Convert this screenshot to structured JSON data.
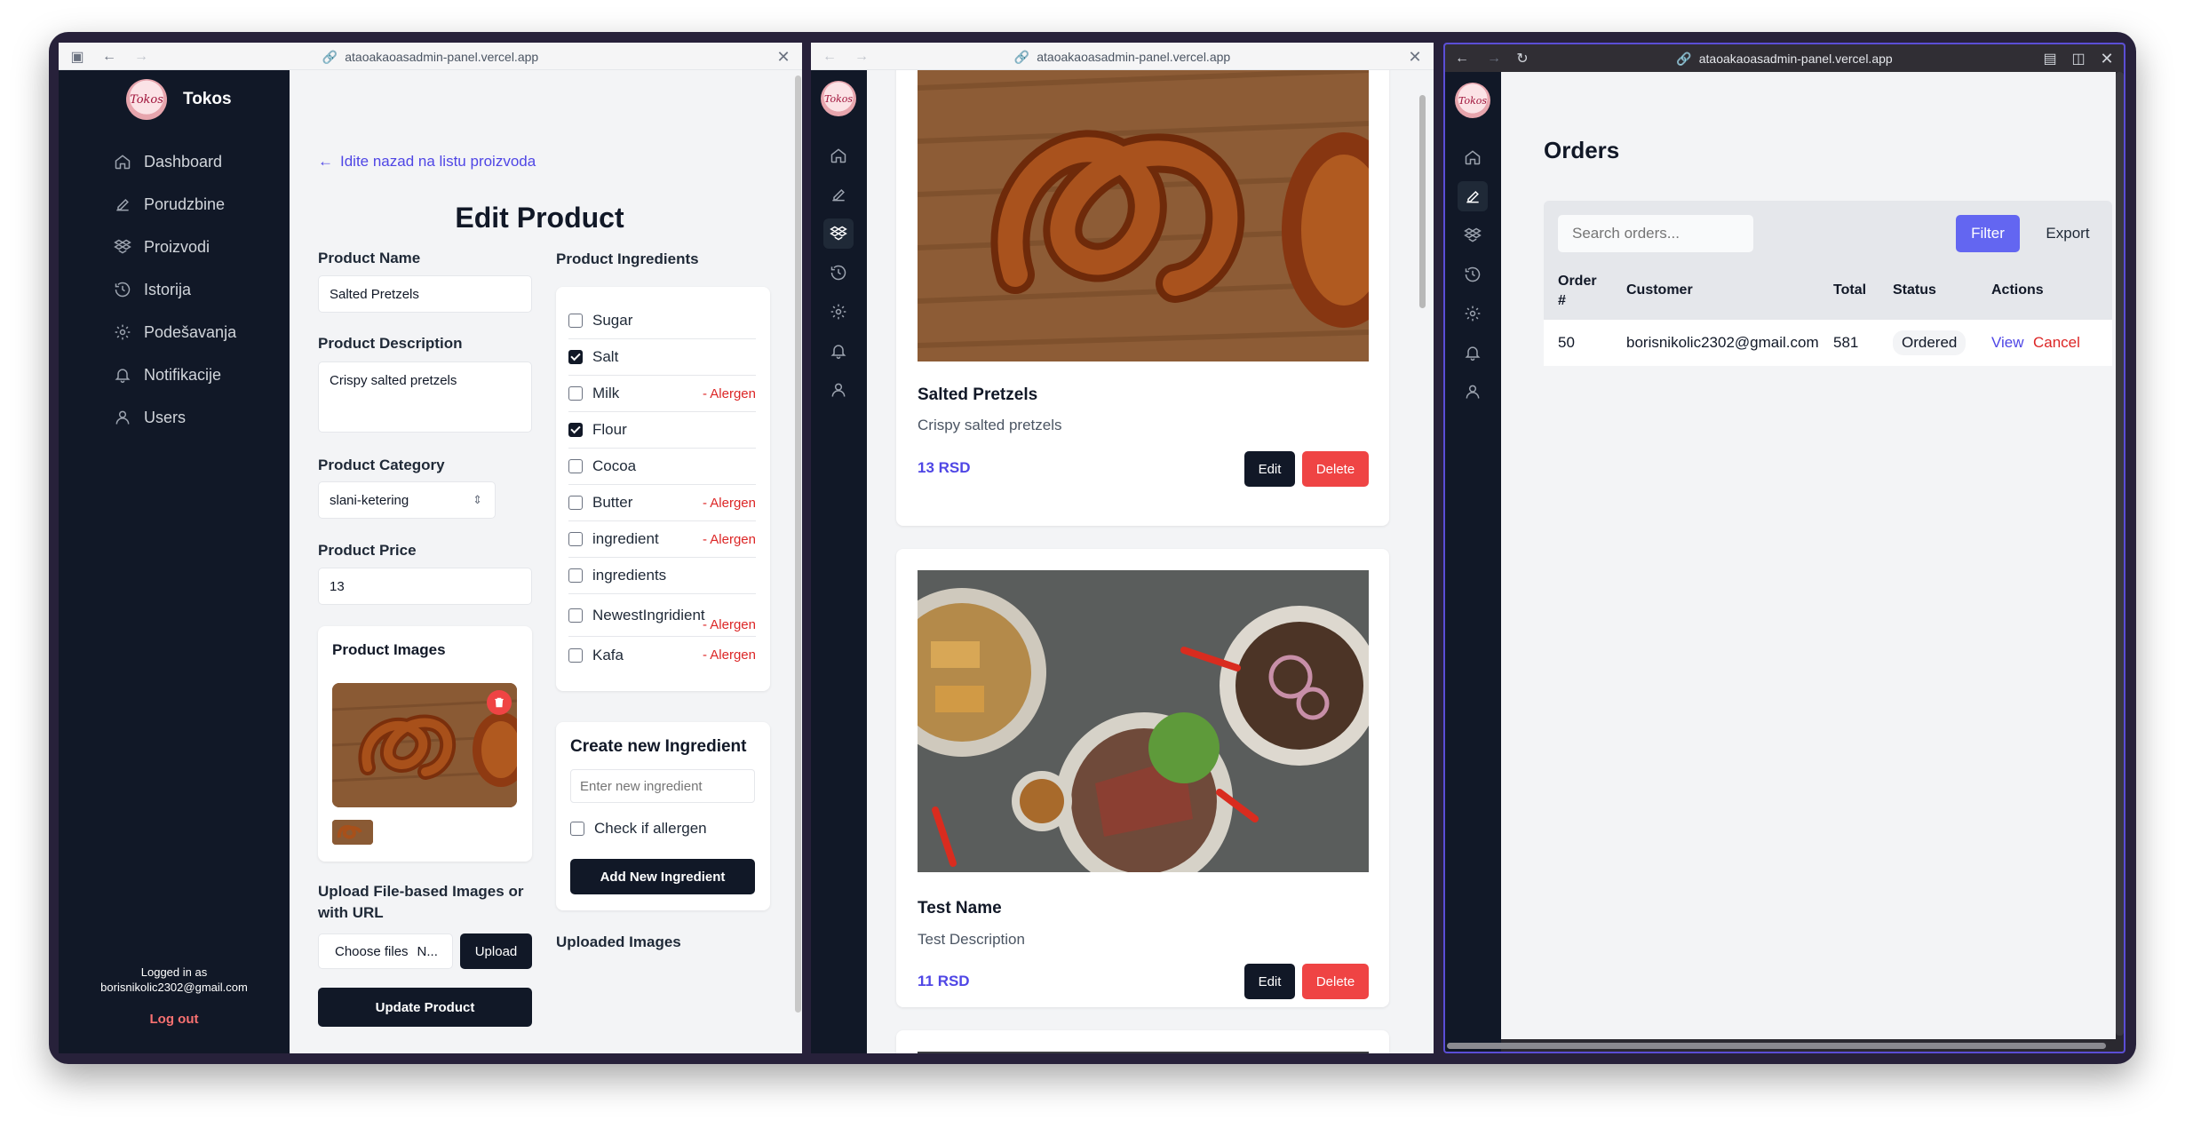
{
  "win1": {
    "url": "ataoakaoasadmin-panel.vercel.app",
    "brand": "Tokos",
    "logo_text": "Tokos",
    "nav": [
      {
        "label": "Dashboard",
        "icon": "home-icon"
      },
      {
        "label": "Porudzbine",
        "icon": "pencil-icon"
      },
      {
        "label": "Proizvodi",
        "icon": "dropbox-icon"
      },
      {
        "label": "Istorija",
        "icon": "history-icon"
      },
      {
        "label": "Podešavanja",
        "icon": "gear-icon"
      },
      {
        "label": "Notifikacije",
        "icon": "bell-icon"
      },
      {
        "label": "Users",
        "icon": "user-icon"
      }
    ],
    "logged_in_label": "Logged in as",
    "logged_in_email": "borisnikolic2302@gmail.com",
    "logout": "Log out",
    "back_link": "Idite nazad na listu proizvoda",
    "title": "Edit Product",
    "name_label": "Product Name",
    "name_value": "Salted Pretzels",
    "desc_label": "Product Description",
    "desc_value": "Crispy salted pretzels",
    "category_label": "Product Category",
    "category_value": "slani-ketering",
    "price_label": "Product Price",
    "price_value": "13",
    "images_label": "Product Images",
    "upload_label": "Upload File-based Images or with URL",
    "choose_files": "Choose files",
    "no_file": "N...",
    "upload_btn": "Upload",
    "update_btn": "Update Product",
    "ingredients_label": "Product Ingredients",
    "ingredients": [
      {
        "name": "Sugar",
        "checked": false,
        "allergen": ""
      },
      {
        "name": "Salt",
        "checked": true,
        "allergen": ""
      },
      {
        "name": "Milk",
        "checked": false,
        "allergen": "- Alergen"
      },
      {
        "name": "Flour",
        "checked": true,
        "allergen": ""
      },
      {
        "name": "Cocoa",
        "checked": false,
        "allergen": ""
      },
      {
        "name": "Butter",
        "checked": false,
        "allergen": "- Alergen"
      },
      {
        "name": "ingredient",
        "checked": false,
        "allergen": "- Alergen"
      },
      {
        "name": "ingredients",
        "checked": false,
        "allergen": ""
      },
      {
        "name": "NewestIngridient",
        "checked": false,
        "allergen": "- Alergen"
      },
      {
        "name": "Kafa",
        "checked": false,
        "allergen": "- Alergen"
      }
    ],
    "create_title": "Create new Ingredient",
    "create_placeholder": "Enter new ingredient",
    "check_allergen": "Check if allergen",
    "add_btn": "Add New Ingredient",
    "uploaded_images": "Uploaded Images"
  },
  "win2": {
    "url": "ataoakaoasadmin-panel.vercel.app",
    "products": [
      {
        "name": "Salted Pretzels",
        "description": "Crispy salted pretzels",
        "price": "13 RSD",
        "edit": "Edit",
        "delete": "Delete"
      },
      {
        "name": "Test Name",
        "description": "Test Description",
        "price": "11 RSD",
        "edit": "Edit",
        "delete": "Delete"
      }
    ]
  },
  "win3": {
    "url": "ataoakaoasadmin-panel.vercel.app",
    "title": "Orders",
    "search_placeholder": "Search orders...",
    "filter": "Filter",
    "export": "Export",
    "columns": [
      "Order #",
      "Customer",
      "Total",
      "Status",
      "Actions"
    ],
    "rows": [
      {
        "order": "50",
        "customer": "borisnikolic2302@gmail.com",
        "total": "581",
        "status": "Ordered",
        "view": "View",
        "cancel": "Cancel"
      }
    ]
  },
  "colors": {
    "sidebar": "#111827",
    "accent": "#4f46e5",
    "danger": "#ef4444",
    "filter": "#6366f1"
  }
}
